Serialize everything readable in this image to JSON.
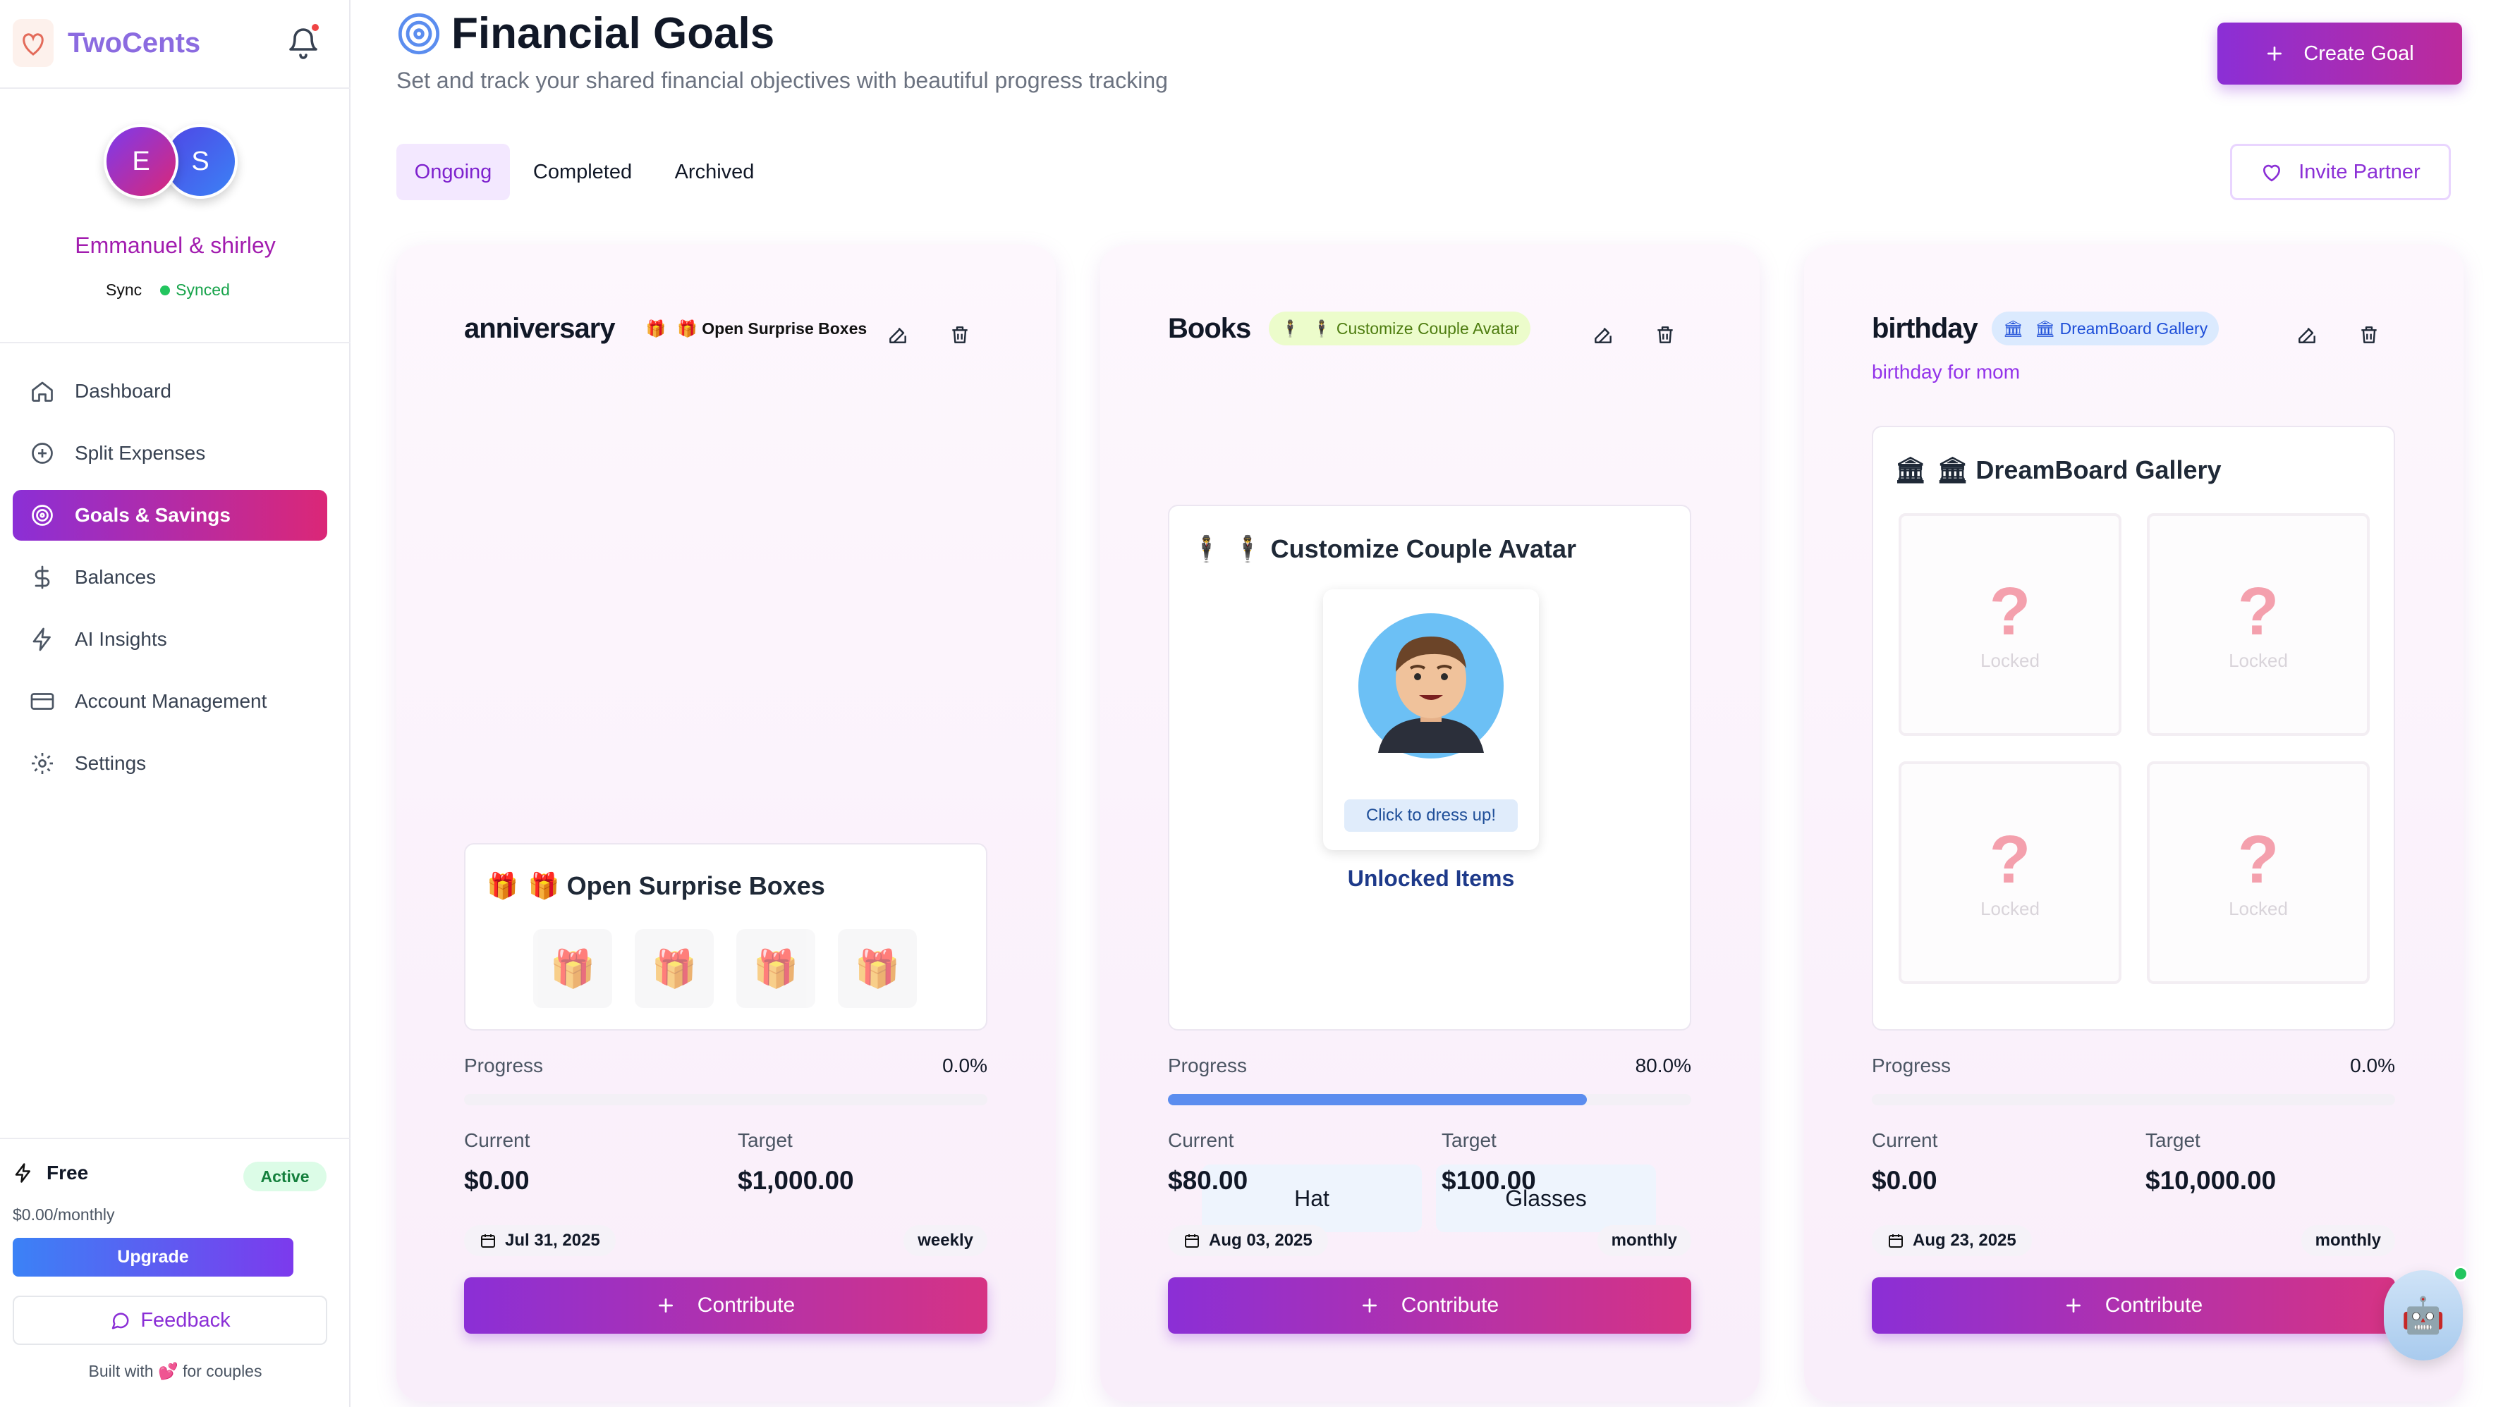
{
  "sidebar": {
    "brand": "TwoCents",
    "brand_logo_text": "TwoCents",
    "avatars": [
      "E",
      "S"
    ],
    "couple_name": "Emmanuel & shirley",
    "sync_label": "Sync",
    "sync_status": "Synced",
    "nav": [
      {
        "label": "Dashboard",
        "icon": "home-icon"
      },
      {
        "label": "Split Expenses",
        "icon": "plus-circle-icon"
      },
      {
        "label": "Goals & Savings",
        "icon": "target-icon",
        "active": true
      },
      {
        "label": "Balances",
        "icon": "dollar-icon"
      },
      {
        "label": "AI Insights",
        "icon": "bolt-icon"
      },
      {
        "label": "Account Management",
        "icon": "credit-card-icon"
      },
      {
        "label": "Settings",
        "icon": "gear-icon"
      }
    ],
    "plan": {
      "name": "Free",
      "status": "Active",
      "price": "$0.00/monthly",
      "upgrade": "Upgrade"
    },
    "feedback": "Feedback",
    "footer_prefix": "Built with",
    "footer_heart": "💕",
    "footer_suffix": "for couples"
  },
  "header": {
    "title": "Financial Goals",
    "subtitle": "Set and track your shared financial objectives with beautiful progress tracking",
    "create_button": "Create Goal",
    "invite_button": "Invite Partner"
  },
  "tabs": [
    "Ongoing",
    "Completed",
    "Archived"
  ],
  "goals": [
    {
      "title": "anniversary",
      "badge_icon": "🎁",
      "badge": "🎁 Open Surprise Boxes",
      "description": "",
      "panel_icon": "🎁",
      "panel_title": "🎁 Open Surprise Boxes",
      "gifts": [
        "🎁",
        "🎁",
        "🎁",
        "🎁"
      ],
      "progress_label": "Progress",
      "progress_text": "0.0%",
      "progress": 0.0,
      "current_label": "Current",
      "current": "$0.00",
      "target_label": "Target",
      "target": "$1,000.00",
      "date": "Jul 31, 2025",
      "frequency": "weekly",
      "contribute": "Contribute"
    },
    {
      "title": "Books",
      "badge_icon": "🕴",
      "badge": "🕴 Customize Couple Avatar",
      "description": "",
      "panel_icon": "🕴",
      "panel_title": "🕴 Customize Couple Avatar",
      "avatar_caption": "Click to dress up!",
      "unlocked_title": "Unlocked Items",
      "unlocked_items": [
        "Hat",
        "Glasses"
      ],
      "progress_label": "Progress",
      "progress_text": "80.0%",
      "progress": 80.0,
      "current_label": "Current",
      "current": "$80.00",
      "target_label": "Target",
      "target": "$100.00",
      "date": "Aug 03, 2025",
      "frequency": "monthly",
      "contribute": "Contribute"
    },
    {
      "title": "birthday",
      "badge_icon": "🏛",
      "badge": "🏛 DreamBoard Gallery",
      "description": "birthday for mom",
      "panel_icon": "🏛",
      "panel_title": "🏛 DreamBoard Gallery",
      "locked_cells": [
        {
          "mark": "?",
          "label": "Locked"
        },
        {
          "mark": "?",
          "label": "Locked"
        },
        {
          "mark": "?",
          "label": "Locked"
        },
        {
          "mark": "?",
          "label": "Locked"
        }
      ],
      "progress_label": "Progress",
      "progress_text": "0.0%",
      "progress": 0.0,
      "current_label": "Current",
      "current": "$0.00",
      "target_label": "Target",
      "target": "$10,000.00",
      "date": "Aug 23, 2025",
      "frequency": "monthly",
      "contribute": "Contribute"
    }
  ],
  "assistant": {
    "icon": "🤖"
  },
  "colors": {
    "accent": "#8b2fd6",
    "pink": "#db2777",
    "progress": "#5b8def",
    "success": "#22c55e"
  }
}
